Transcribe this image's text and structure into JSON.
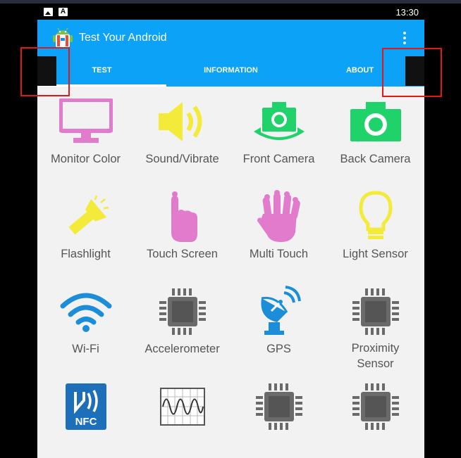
{
  "status_bar": {
    "time": "13:30",
    "icons": [
      "image-icon",
      "a-icon"
    ]
  },
  "app": {
    "title": "Test Your Android",
    "tabs": [
      {
        "label": "TEST",
        "active": true
      },
      {
        "label": "INFORMATION",
        "active": false
      },
      {
        "label": "ABOUT",
        "active": false
      }
    ]
  },
  "tiles": [
    {
      "label": "Monitor Color",
      "icon": "monitor-icon",
      "color": "#e27bcc"
    },
    {
      "label": "Sound/Vibrate",
      "icon": "speaker-icon",
      "color": "#f3ea3a"
    },
    {
      "label": "Front Camera",
      "icon": "front-camera-icon",
      "color": "#1fd36a"
    },
    {
      "label": "Back Camera",
      "icon": "back-camera-icon",
      "color": "#1fd36a"
    },
    {
      "label": "Flashlight",
      "icon": "flashlight-icon",
      "color": "#f3ea3a"
    },
    {
      "label": "Touch Screen",
      "icon": "touch-finger-icon",
      "color": "#e27bcc"
    },
    {
      "label": "Multi Touch",
      "icon": "multi-touch-hand-icon",
      "color": "#e27bcc"
    },
    {
      "label": "Light Sensor",
      "icon": "light-bulb-icon",
      "color": "#f3ea3a"
    },
    {
      "label": "Wi-Fi",
      "icon": "wifi-icon",
      "color": "#1c8ed9"
    },
    {
      "label": "Accelerometer",
      "icon": "chip-icon",
      "color": "#6a6a6a"
    },
    {
      "label": "GPS",
      "icon": "satellite-dish-icon",
      "color": "#1c8ed9"
    },
    {
      "label": "Proximity\nSensor",
      "icon": "chip-icon",
      "color": "#6a6a6a"
    },
    {
      "label": "",
      "icon": "nfc-icon",
      "color": "#1c6fb8",
      "badge": "NFC"
    },
    {
      "label": "",
      "icon": "waveform-icon",
      "color": "#555555"
    },
    {
      "label": "",
      "icon": "chip-icon",
      "color": "#6a6a6a"
    },
    {
      "label": "",
      "icon": "chip-icon",
      "color": "#6a6a6a"
    }
  ]
}
